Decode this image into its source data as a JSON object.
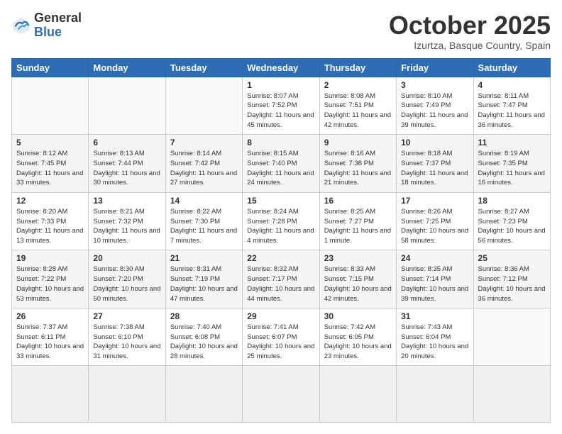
{
  "logo": {
    "general": "General",
    "blue": "Blue"
  },
  "header": {
    "month": "October 2025",
    "location": "Izurtza, Basque Country, Spain"
  },
  "weekdays": [
    "Sunday",
    "Monday",
    "Tuesday",
    "Wednesday",
    "Thursday",
    "Friday",
    "Saturday"
  ],
  "days": [
    {
      "date": "",
      "info": ""
    },
    {
      "date": "",
      "info": ""
    },
    {
      "date": "",
      "info": ""
    },
    {
      "date": "1",
      "info": "Sunrise: 8:07 AM\nSunset: 7:52 PM\nDaylight: 11 hours\nand 45 minutes."
    },
    {
      "date": "2",
      "info": "Sunrise: 8:08 AM\nSunset: 7:51 PM\nDaylight: 11 hours\nand 42 minutes."
    },
    {
      "date": "3",
      "info": "Sunrise: 8:10 AM\nSunset: 7:49 PM\nDaylight: 11 hours\nand 39 minutes."
    },
    {
      "date": "4",
      "info": "Sunrise: 8:11 AM\nSunset: 7:47 PM\nDaylight: 11 hours\nand 36 minutes."
    },
    {
      "date": "5",
      "info": "Sunrise: 8:12 AM\nSunset: 7:45 PM\nDaylight: 11 hours\nand 33 minutes."
    },
    {
      "date": "6",
      "info": "Sunrise: 8:13 AM\nSunset: 7:44 PM\nDaylight: 11 hours\nand 30 minutes."
    },
    {
      "date": "7",
      "info": "Sunrise: 8:14 AM\nSunset: 7:42 PM\nDaylight: 11 hours\nand 27 minutes."
    },
    {
      "date": "8",
      "info": "Sunrise: 8:15 AM\nSunset: 7:40 PM\nDaylight: 11 hours\nand 24 minutes."
    },
    {
      "date": "9",
      "info": "Sunrise: 8:16 AM\nSunset: 7:38 PM\nDaylight: 11 hours\nand 21 minutes."
    },
    {
      "date": "10",
      "info": "Sunrise: 8:18 AM\nSunset: 7:37 PM\nDaylight: 11 hours\nand 18 minutes."
    },
    {
      "date": "11",
      "info": "Sunrise: 8:19 AM\nSunset: 7:35 PM\nDaylight: 11 hours\nand 16 minutes."
    },
    {
      "date": "12",
      "info": "Sunrise: 8:20 AM\nSunset: 7:33 PM\nDaylight: 11 hours\nand 13 minutes."
    },
    {
      "date": "13",
      "info": "Sunrise: 8:21 AM\nSunset: 7:32 PM\nDaylight: 11 hours\nand 10 minutes."
    },
    {
      "date": "14",
      "info": "Sunrise: 8:22 AM\nSunset: 7:30 PM\nDaylight: 11 hours\nand 7 minutes."
    },
    {
      "date": "15",
      "info": "Sunrise: 8:24 AM\nSunset: 7:28 PM\nDaylight: 11 hours\nand 4 minutes."
    },
    {
      "date": "16",
      "info": "Sunrise: 8:25 AM\nSunset: 7:27 PM\nDaylight: 11 hours\nand 1 minute."
    },
    {
      "date": "17",
      "info": "Sunrise: 8:26 AM\nSunset: 7:25 PM\nDaylight: 10 hours\nand 58 minutes."
    },
    {
      "date": "18",
      "info": "Sunrise: 8:27 AM\nSunset: 7:23 PM\nDaylight: 10 hours\nand 56 minutes."
    },
    {
      "date": "19",
      "info": "Sunrise: 8:28 AM\nSunset: 7:22 PM\nDaylight: 10 hours\nand 53 minutes."
    },
    {
      "date": "20",
      "info": "Sunrise: 8:30 AM\nSunset: 7:20 PM\nDaylight: 10 hours\nand 50 minutes."
    },
    {
      "date": "21",
      "info": "Sunrise: 8:31 AM\nSunset: 7:19 PM\nDaylight: 10 hours\nand 47 minutes."
    },
    {
      "date": "22",
      "info": "Sunrise: 8:32 AM\nSunset: 7:17 PM\nDaylight: 10 hours\nand 44 minutes."
    },
    {
      "date": "23",
      "info": "Sunrise: 8:33 AM\nSunset: 7:15 PM\nDaylight: 10 hours\nand 42 minutes."
    },
    {
      "date": "24",
      "info": "Sunrise: 8:35 AM\nSunset: 7:14 PM\nDaylight: 10 hours\nand 39 minutes."
    },
    {
      "date": "25",
      "info": "Sunrise: 8:36 AM\nSunset: 7:12 PM\nDaylight: 10 hours\nand 36 minutes."
    },
    {
      "date": "26",
      "info": "Sunrise: 7:37 AM\nSunset: 6:11 PM\nDaylight: 10 hours\nand 33 minutes."
    },
    {
      "date": "27",
      "info": "Sunrise: 7:38 AM\nSunset: 6:10 PM\nDaylight: 10 hours\nand 31 minutes."
    },
    {
      "date": "28",
      "info": "Sunrise: 7:40 AM\nSunset: 6:08 PM\nDaylight: 10 hours\nand 28 minutes."
    },
    {
      "date": "29",
      "info": "Sunrise: 7:41 AM\nSunset: 6:07 PM\nDaylight: 10 hours\nand 25 minutes."
    },
    {
      "date": "30",
      "info": "Sunrise: 7:42 AM\nSunset: 6:05 PM\nDaylight: 10 hours\nand 23 minutes."
    },
    {
      "date": "31",
      "info": "Sunrise: 7:43 AM\nSunset: 6:04 PM\nDaylight: 10 hours\nand 20 minutes."
    },
    {
      "date": "",
      "info": ""
    }
  ]
}
